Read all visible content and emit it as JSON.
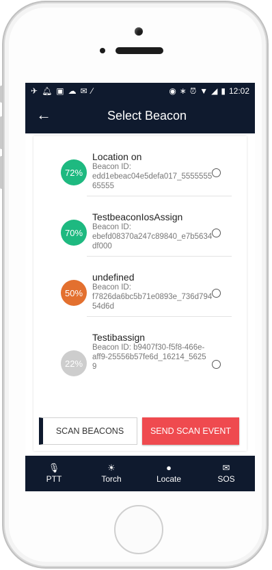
{
  "status_bar": {
    "left_icons": [
      "airplane-icon",
      "bell-icon",
      "image-icon",
      "cloud-icon",
      "mail-icon",
      "broom-icon"
    ],
    "right_icons": [
      "target-icon",
      "bluetooth-icon",
      "alarm-icon",
      "wifi-icon",
      "signal-icon",
      "battery-icon"
    ],
    "time": "12:02"
  },
  "header": {
    "title": "Select Beacon",
    "back_icon": "back-arrow-icon"
  },
  "beacons": [
    {
      "percent": "72%",
      "color": "#1eb980",
      "name": "Location on",
      "id_label": "Beacon ID:",
      "id_value": "edd1ebeac04e5defa017_555555565555",
      "selected": false
    },
    {
      "percent": "70%",
      "color": "#1eb980",
      "name": "TestbeaconIosAssign",
      "id_label": "Beacon ID:",
      "id_value": "ebefd08370a247c89840_e7b5634df000",
      "selected": false
    },
    {
      "percent": "50%",
      "color": "#e3702f",
      "name": "undefined",
      "id_label": "Beacon ID:",
      "id_value": "f7826da6bc5b71e0893e_736d79454d6d",
      "selected": false
    },
    {
      "percent": "22%",
      "color": "#cdcdcd",
      "name": "Testibassign",
      "id_label": "Beacon ID:",
      "id_value": "b9407f30-f5f8-466e-aff9-25556b57fe6d_16214_56259",
      "selected": false
    }
  ],
  "actions": {
    "scan_label": "SCAN BEACONS",
    "send_label": "SEND SCAN EVENT",
    "send_color": "#ef4a4f"
  },
  "bottom_nav": [
    {
      "label": "PTT",
      "icon": "microphone-icon"
    },
    {
      "label": "Torch",
      "icon": "sun-icon"
    },
    {
      "label": "Locate",
      "icon": "pin-icon"
    },
    {
      "label": "SOS",
      "icon": "envelope-icon"
    }
  ],
  "theme": {
    "dark_navy": "#0f1a2e"
  }
}
